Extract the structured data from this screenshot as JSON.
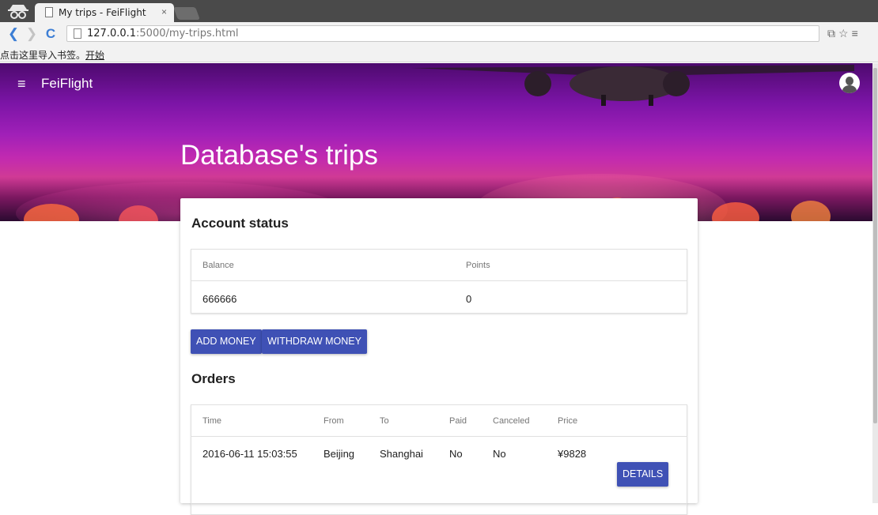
{
  "browser": {
    "tab_title": "My trips - FeiFlight",
    "tab_close": "×",
    "url_host": "127.0.0.1",
    "url_rest": ":5000/my-trips.html",
    "bookmark_hint": "点击这里导入书签。",
    "bookmark_start": "开始",
    "icons": [
      "incognito-icon",
      "page-icon",
      "back-arrow-icon",
      "forward-arrow-icon",
      "reload-icon",
      "translate-icon",
      "star-icon",
      "menu-icon"
    ]
  },
  "header": {
    "menu_glyph": "≡",
    "brand": "FeiFlight",
    "page_title": "Database's trips"
  },
  "account": {
    "section_title": "Account status",
    "columns": [
      "Balance",
      "Points"
    ],
    "balance": "666666",
    "points": "0"
  },
  "actions": {
    "add_money": "ADD MONEY",
    "withdraw_money": "WITHDRAW MONEY"
  },
  "orders": {
    "section_title": "Orders",
    "columns": [
      "Time",
      "From",
      "To",
      "Paid",
      "Canceled",
      "Price"
    ],
    "rows": [
      {
        "time": "2016-06-11 15:03:55",
        "from": "Beijing",
        "to": "Shanghai",
        "paid": "No",
        "canceled": "No",
        "price": "¥9828",
        "details": "DETAILS"
      }
    ]
  },
  "colors": {
    "primary": "#3f51b5",
    "hero_start": "#4d0a6e",
    "hero_mid": "#c22ab0"
  }
}
